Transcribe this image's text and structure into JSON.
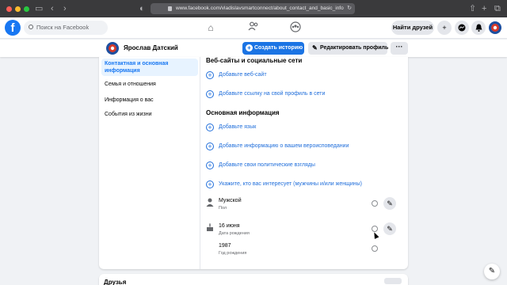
{
  "browser": {
    "url": "www.facebook.com/vladislavsmartconnect/about_contact_and_basic_info"
  },
  "fbnav": {
    "search_placeholder": "Поиск на Facebook",
    "find_friends": "Найти друзей"
  },
  "profile": {
    "name": "Ярослав Датский",
    "create_story": "Создать историю",
    "edit_profile": "Редактировать профиль",
    "more": "···"
  },
  "sidebar": {
    "items": [
      {
        "label": "Контактная и основная информация",
        "active": true
      },
      {
        "label": "Семья и отношения"
      },
      {
        "label": "Информация о вас"
      },
      {
        "label": "События из жизни"
      }
    ]
  },
  "content": {
    "websites_title": "Веб-сайты и социальные сети",
    "add_website": "Добавьте веб-сайт",
    "add_social_link": "Добавьте ссылку на свой профиль в сети",
    "basic_info_title": "Основная информация",
    "add_language": "Добавьте язык",
    "add_religion": "Добавьте информацию о вашем вероисповедании",
    "add_politics": "Добавьте свои политические взгляды",
    "add_interested_in": "Укажите, кто вас интересует (мужчины и/или женщины)",
    "gender_value": "Мужской",
    "gender_label": "Пол",
    "birthdate_value": "16 июня",
    "birthdate_label": "Дата рождения",
    "birthyear_value": "1987",
    "birthyear_label": "Год рождения"
  },
  "lower_card": {
    "title": "Друзья"
  },
  "colors": {
    "fb_blue": "#1877f2",
    "link_blue": "#216fdb",
    "bg": "#f0f2f5"
  }
}
